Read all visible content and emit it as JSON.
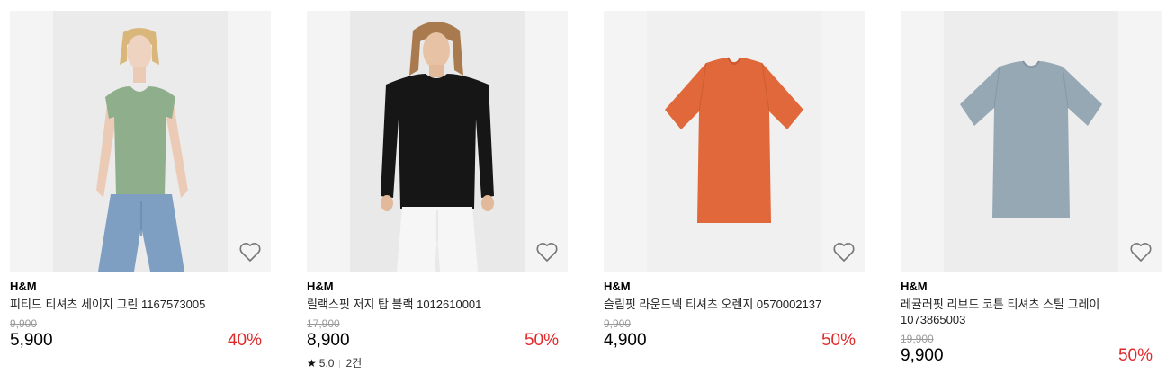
{
  "products": [
    {
      "brand": "H&M",
      "name": "피티드 티셔츠 세이지 그린 1167573005",
      "original_price": "9,900",
      "price": "5,900",
      "discount": "40%",
      "shirt_color": "#8fae8c"
    },
    {
      "brand": "H&M",
      "name": "릴랙스핏 저지 탑 블랙 1012610001",
      "original_price": "17,900",
      "price": "8,900",
      "discount": "50%",
      "rating": "5.0",
      "review_count": "2건",
      "shirt_color": "#161616"
    },
    {
      "brand": "H&M",
      "name": "슬림핏 라운드넥 티셔츠 오렌지 0570002137",
      "original_price": "9,900",
      "price": "4,900",
      "discount": "50%",
      "shirt_color": "#e0683a"
    },
    {
      "brand": "H&M",
      "name": "레귤러핏 리브드 코튼 티셔츠 스틸 그레이 1073865003",
      "original_price": "19,900",
      "price": "9,900",
      "discount": "50%",
      "shirt_color": "#97a8b5"
    }
  ],
  "icons": {
    "wishlist": "heart-outline-icon",
    "rating": "star-icon"
  },
  "colors": {
    "discount": "#e0292a",
    "strikethrough": "#9a9a9a",
    "image_background": "#f4f4f4"
  }
}
